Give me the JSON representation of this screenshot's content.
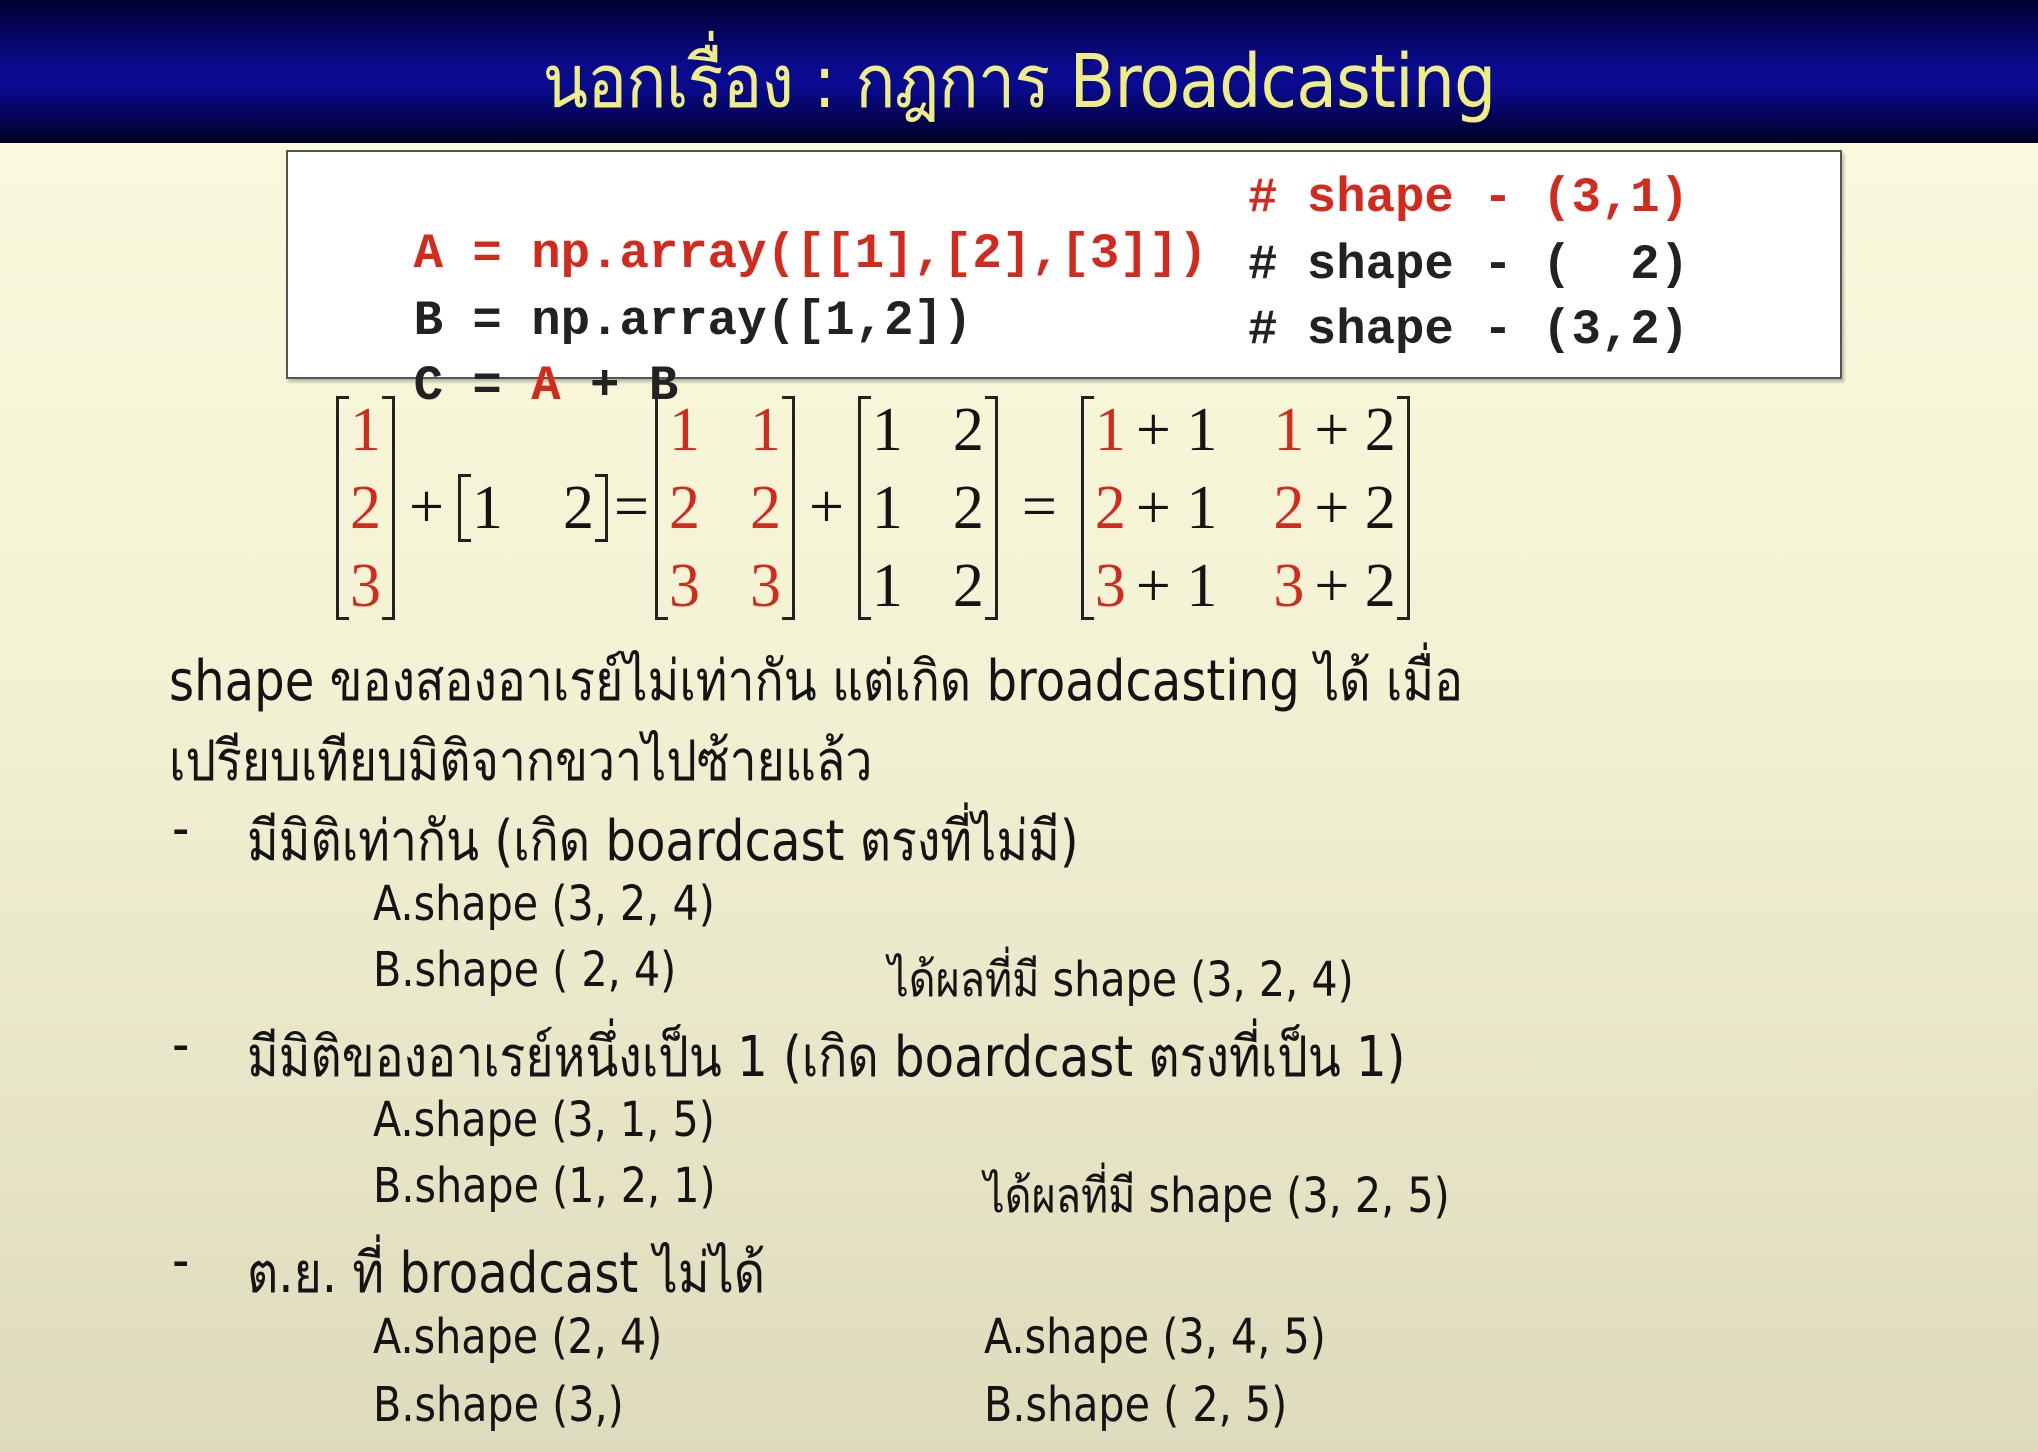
{
  "title": "นอกเรื่อง : กฎการ Broadcasting",
  "colors": {
    "accent_red": "#d42a1e",
    "title_text": "#eeee82",
    "title_bar": "#0a0a8c"
  },
  "code": {
    "lines": [
      {
        "code": "A = np.array([[1],[2],[3]])",
        "comment": "# shape - (3,1)",
        "red": true
      },
      {
        "code": "B = np.array([1,2])",
        "comment": "# shape - (  2)",
        "red": false
      },
      {
        "code_pre": "C = ",
        "code_red": "A",
        "code_post": " + B",
        "comment": "# shape - (3,2)"
      }
    ]
  },
  "equation": {
    "m1": [
      [
        "1"
      ],
      [
        "2"
      ],
      [
        "3"
      ]
    ],
    "plus1": "+",
    "row": [
      "1",
      "2"
    ],
    "eq1": "=",
    "m2": [
      [
        "1",
        "1"
      ],
      [
        "2",
        "2"
      ],
      [
        "3",
        "3"
      ]
    ],
    "plus2": "+",
    "m3": [
      [
        "1",
        "2"
      ],
      [
        "1",
        "2"
      ],
      [
        "1",
        "2"
      ]
    ],
    "eq2": "=",
    "m4": [
      [
        "1",
        "+ 1",
        "1",
        "+ 2"
      ],
      [
        "2",
        "+ 1",
        "2",
        "+ 2"
      ],
      [
        "3",
        "+ 1",
        "3",
        "+ 2"
      ]
    ]
  },
  "body": {
    "intro_line1": "shape ของสองอาเรย์ไม่เท่ากัน แต่เกิด broadcasting ได้ เมื่อ",
    "intro_line2": "เปรียบเทียบมิติจากขวาไปซ้ายแล้ว",
    "bullets": [
      {
        "dash": "-",
        "text": "มีมิติเท่ากัน (เกิด boardcast ตรงที่ไม่มี)",
        "a": "A.shape (3, 2, 4)",
        "b": "B.shape (    2, 4)",
        "result": "ได้ผลที่มี shape (3, 2, 4)"
      },
      {
        "dash": "-",
        "text": "มีมิติของอาเรย์หนึ่งเป็น 1 (เกิด boardcast ตรงที่เป็น 1)",
        "a": "A.shape (3, 1, 5)",
        "b": "B.shape (1, 2, 1)",
        "result": "ได้ผลที่มี shape (3, 2, 5)"
      },
      {
        "dash": "-",
        "text": "ต.ย. ที่ broadcast ไม่ได้",
        "a": "A.shape (2, 4)",
        "b": "B.shape (3,)",
        "a2": "A.shape (3, 4, 5)",
        "b2": "B.shape (    2, 5)"
      }
    ]
  }
}
